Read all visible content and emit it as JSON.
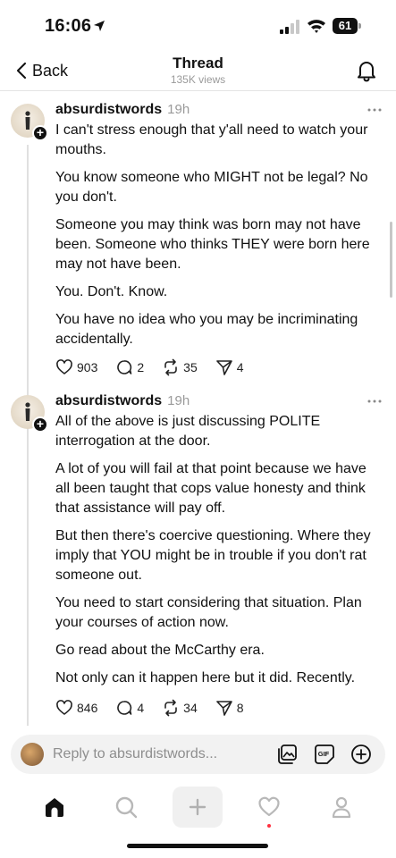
{
  "status_bar": {
    "time": "16:06",
    "battery": "61"
  },
  "header": {
    "back_label": "Back",
    "title": "Thread",
    "views": "135K views"
  },
  "posts": [
    {
      "username": "absurdistwords",
      "time": "19h",
      "paragraphs": [
        "I can't stress enough that y'all need to watch your mouths.",
        "You know someone who MIGHT not be legal? No you don't.",
        "Someone you may think was born may not have been.  Someone who thinks THEY were born here may not have been.",
        "You. Don't.  Know.",
        "You have no idea who you may be incriminating accidentally."
      ],
      "likes": "903",
      "replies": "2",
      "reposts": "35",
      "shares": "4"
    },
    {
      "username": "absurdistwords",
      "time": "19h",
      "paragraphs": [
        "All of the above is just discussing POLITE interrogation at the door.",
        "A lot of you will fail at that point because we have all been taught that cops value honesty and think that assistance will pay off.",
        "But then there's coercive questioning. Where they imply that YOU might be in trouble if you don't rat someone out.",
        "You need to start considering that situation. Plan your courses of action now.",
        "Go read about the McCarthy era.",
        "Not only can it happen here but it did.  Recently."
      ],
      "likes": "846",
      "replies": "4",
      "reposts": "34",
      "shares": "8"
    }
  ],
  "reply_bar": {
    "placeholder": "Reply to absurdistwords..."
  },
  "colors": {
    "accent": "#111111",
    "muted": "#9a9a9a",
    "notification_dot": "#ff3040"
  },
  "tabs": [
    "home-icon",
    "search-icon",
    "compose-icon",
    "heart-icon",
    "profile-icon"
  ]
}
